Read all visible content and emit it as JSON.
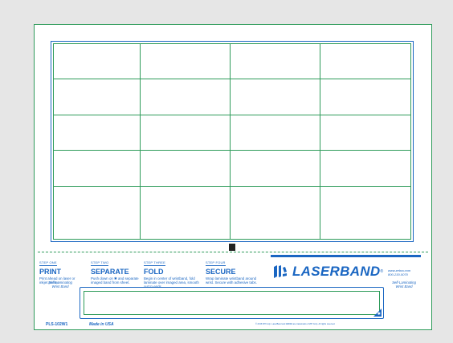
{
  "colors": {
    "page_bg": "#e6e6e6",
    "sheet_bg": "#ffffff",
    "green": "#2e9b5a",
    "blue": "#1a66c2"
  },
  "steps": [
    {
      "num": "STEP ONE",
      "title": "PRINT",
      "desc": "Print ahead on laser or inkjet printer."
    },
    {
      "num": "STEP TWO",
      "title": "SEPARATE",
      "desc": "Push down on ✱ and separate imaged band from sheet."
    },
    {
      "num": "STEP THREE",
      "title": "FOLD",
      "desc": "Begin in center of wristband, fold laminate over imaged area, smooth out to ends."
    },
    {
      "num": "STEP FOUR",
      "title": "SECURE",
      "desc": "Wrap laminate wristband around wrist. Secure with adhesive tabs."
    }
  ],
  "brand": {
    "name": "LASERBAND",
    "registered": "®",
    "icon": "zebra-logo-icon"
  },
  "contact": {
    "url": "www.zebra.com",
    "phone": "800-230-5070"
  },
  "side_label": {
    "line1": "Self-Laminating",
    "line2": "Wrist Band"
  },
  "footer": {
    "part_number": "PLS-102W1",
    "made_in": "Made in USA",
    "legal": "© 2015 ZIH Corp. LaserBand and ZEBRA are trademarks of ZIH Corp. All rights reserved."
  }
}
